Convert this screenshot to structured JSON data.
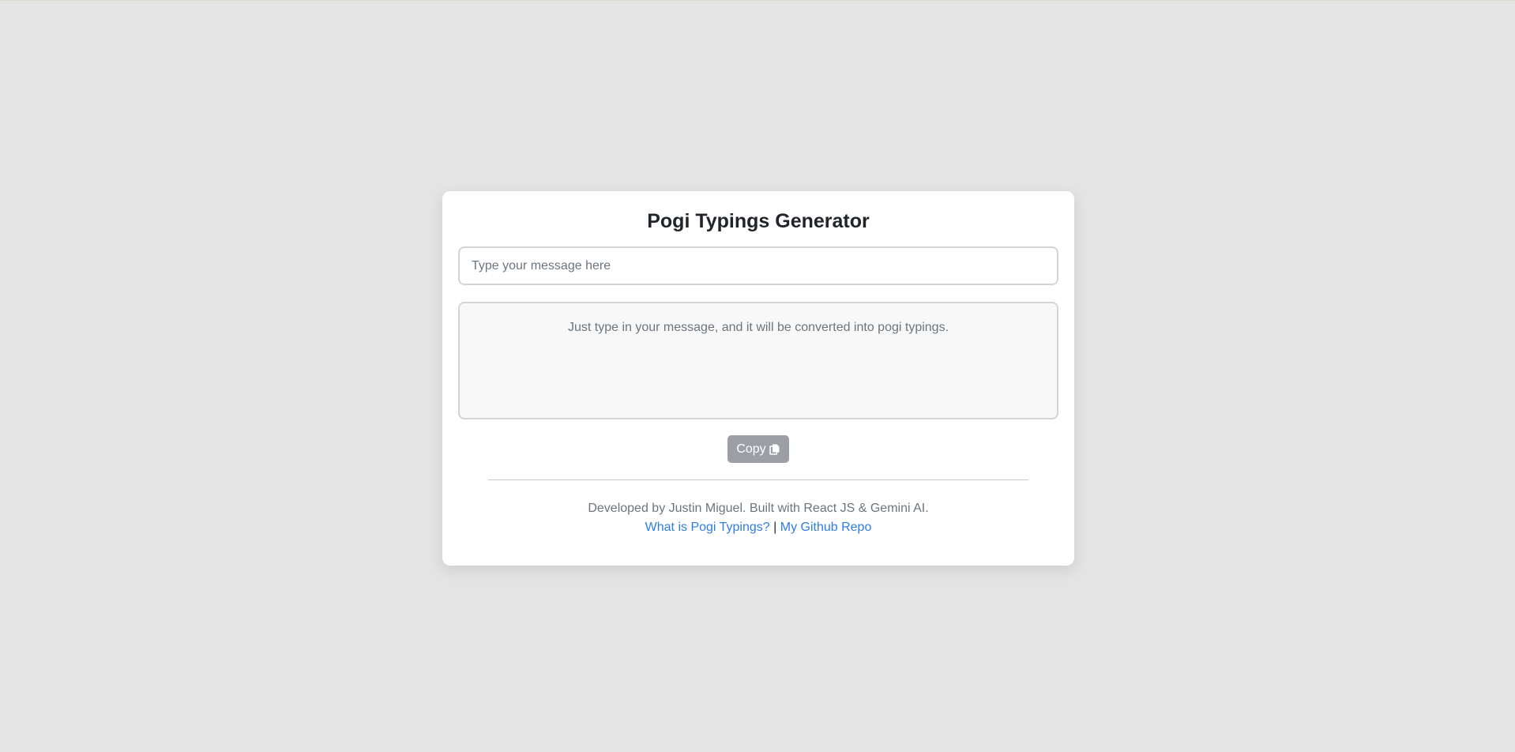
{
  "app": {
    "title": "Pogi Typings Generator"
  },
  "input": {
    "placeholder": "Type your message here",
    "value": ""
  },
  "output": {
    "text": "Just type in your message, and it will be converted into pogi typings."
  },
  "copy_button": {
    "label": "Copy",
    "icon": "copy-icon"
  },
  "footer": {
    "credit": "Developed by Justin Miguel. Built with React JS & Gemini AI.",
    "links": [
      {
        "label": "What is Pogi Typings?"
      },
      {
        "label": "My Github Repo"
      }
    ],
    "separator": "|"
  },
  "colors": {
    "page_background": "#e4e4e4",
    "card_background": "#ffffff",
    "link": "#2f7de1",
    "copy_button": "#9ca0a6",
    "muted_text": "#6c757d"
  }
}
